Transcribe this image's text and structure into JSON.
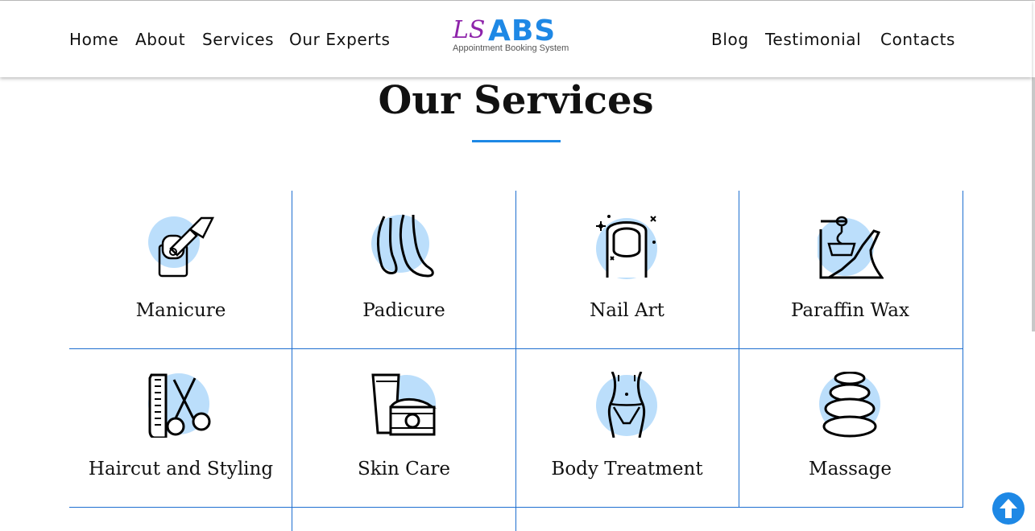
{
  "nav": {
    "left": [
      "Home",
      "About",
      "Services",
      "Our Experts"
    ],
    "right": [
      "Blog",
      "Testimonial",
      "Contacts"
    ]
  },
  "logo": {
    "mark": "LS",
    "name": "ABS",
    "tagline": "Appointment Booking System"
  },
  "section": {
    "title": "Our Services"
  },
  "services": [
    {
      "label": "Manicure",
      "icon": "nail-polish-icon"
    },
    {
      "label": "Padicure",
      "icon": "feet-icon"
    },
    {
      "label": "Nail Art",
      "icon": "nail-icon"
    },
    {
      "label": "Paraffin Wax",
      "icon": "wax-icon"
    },
    {
      "label": "Haircut and Styling",
      "icon": "comb-scissors-icon"
    },
    {
      "label": "Skin Care",
      "icon": "cream-jar-icon"
    },
    {
      "label": "Body Treatment",
      "icon": "body-icon"
    },
    {
      "label": "Massage",
      "icon": "stones-icon"
    }
  ],
  "colors": {
    "accent": "#1e88e5",
    "icon_circle": "#bbdefb",
    "logo_mark": "#8e24aa"
  }
}
